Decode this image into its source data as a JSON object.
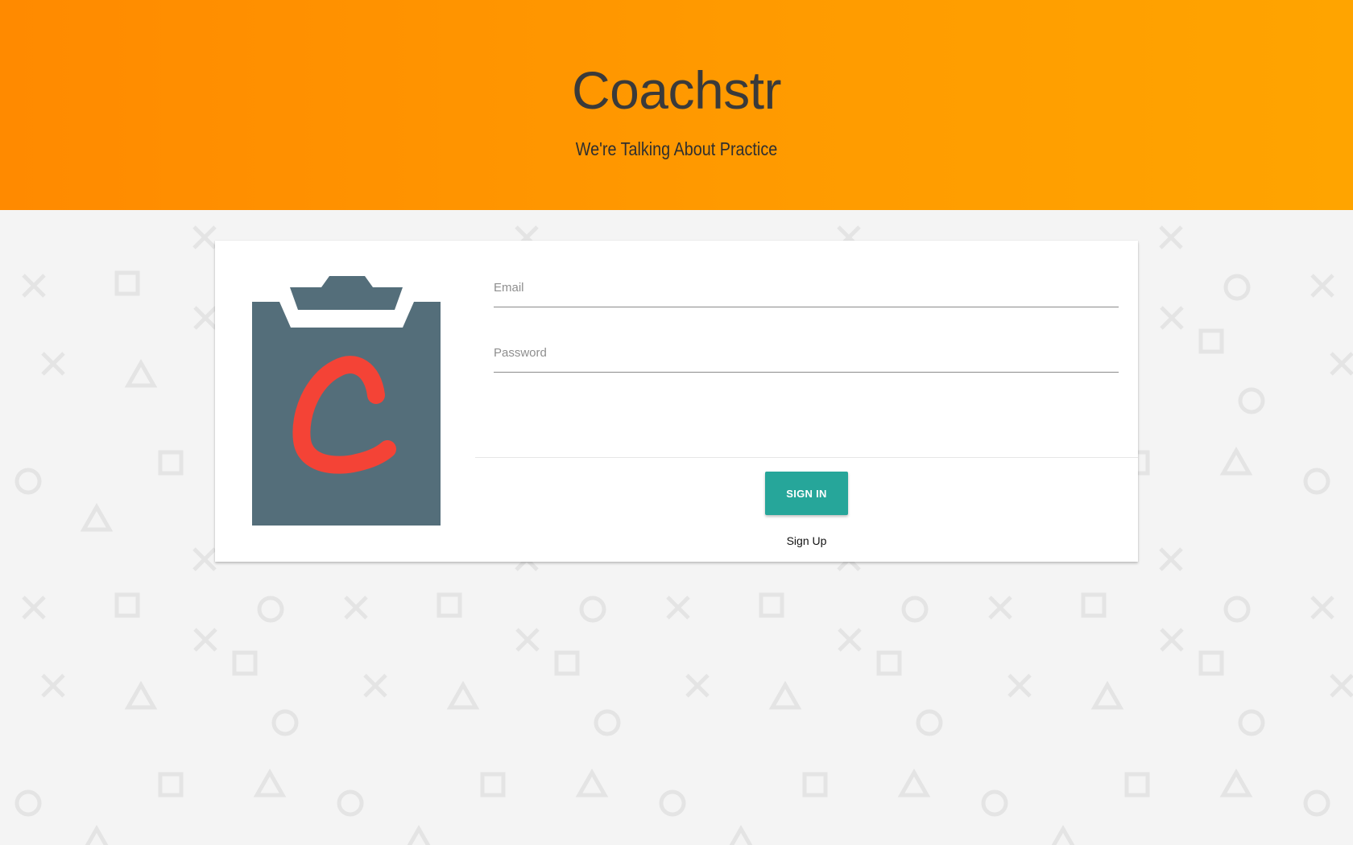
{
  "header": {
    "title": "Coachstr",
    "subtitle": "We're Talking About Practice"
  },
  "login": {
    "logo_letter": "C",
    "email_placeholder": "Email",
    "password_placeholder": "Password",
    "signin_label": "SIGN IN",
    "signup_label": "Sign Up"
  },
  "colors": {
    "header_start": "#ff8a00",
    "header_end": "#ffa400",
    "background": "#f4f4f4",
    "button": "#26a69a",
    "clipboard": "#546e7a",
    "logo_letter": "#f44336"
  },
  "background_pattern": {
    "icons": [
      "cross-icon",
      "square-icon",
      "circle-icon",
      "triangle-icon"
    ]
  }
}
